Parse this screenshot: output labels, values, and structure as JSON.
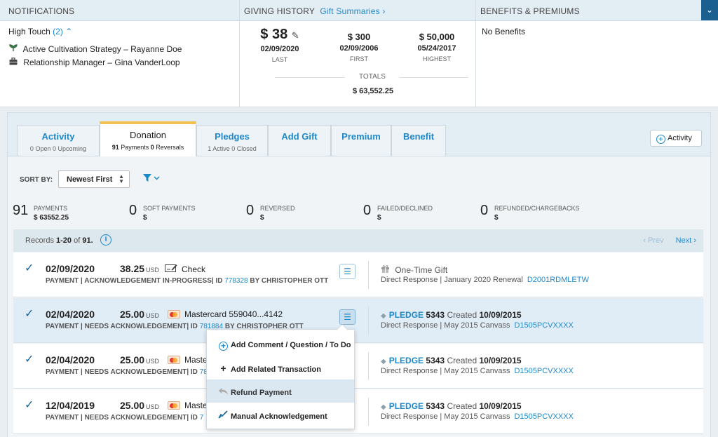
{
  "notifications": {
    "header": "NOTIFICATIONS",
    "high_touch_label": "High Touch",
    "high_touch_count": "(2)",
    "items": [
      {
        "icon": "sprout-icon",
        "text": "Active Cultivation Strategy – Rayanne Doe"
      },
      {
        "icon": "briefcase-icon",
        "text": "Relationship Manager – Gina VanderLoop"
      }
    ]
  },
  "giving_history": {
    "header": "GIVING HISTORY",
    "link": "Gift Summaries",
    "last": {
      "amount": "$ 38",
      "date": "02/09/2020",
      "label": "LAST"
    },
    "first": {
      "amount": "$ 300",
      "date": "02/09/2006",
      "label": "FIRST"
    },
    "highest": {
      "amount": "$ 50,000",
      "date": "05/24/2017",
      "label": "HIGHEST"
    },
    "totals_label": "TOTALS",
    "totals_amount": "$ 63,552.25"
  },
  "benefits": {
    "header": "BENEFITS & PREMIUMS",
    "text": "No Benefits"
  },
  "tabs": [
    {
      "label": "Activity",
      "sub_a_num": "0",
      "sub_a": "Open",
      "sub_b_num": "0",
      "sub_b": "Upcoming"
    },
    {
      "label": "Donation",
      "sub_a_num": "91",
      "sub_a": "Payments",
      "sub_b_num": "0",
      "sub_b": "Reversals"
    },
    {
      "label": "Pledges",
      "sub_a_num": "1",
      "sub_a": "Active",
      "sub_b_num": "0",
      "sub_b": "Closed"
    },
    {
      "label": "Add Gift"
    },
    {
      "label": "Premium"
    },
    {
      "label": "Benefit"
    }
  ],
  "activity_button": "Activity",
  "sort": {
    "label": "SORT BY:",
    "value": "Newest First"
  },
  "stats": [
    {
      "num": "91",
      "label": "PAYMENTS",
      "value": "$ 63552.25"
    },
    {
      "num": "0",
      "label": "SOFT PAYMENTS",
      "value": "$"
    },
    {
      "num": "0",
      "label": "REVERSED",
      "value": "$"
    },
    {
      "num": "0",
      "label": "FAILED/DECLINED",
      "value": "$"
    },
    {
      "num": "0",
      "label": "REFUNDED/CHARGEBACKS",
      "value": "$"
    }
  ],
  "records": {
    "prefix": "Records",
    "range": "1-20",
    "of": "of",
    "total": "91.",
    "prev": "‹ Prev",
    "next": "Next ›"
  },
  "rows": [
    {
      "date": "02/09/2020",
      "amount": "38.25",
      "currency": "USD",
      "method_icon": "check-icon",
      "method": "Check",
      "sub_prefix": "PAYMENT | ACKNOWLEDGEMENT IN-PROGRESS| ID",
      "id": "778328",
      "sub_suffix": "BY CHRISTOPHER OTT",
      "right_icon": "gift-icon",
      "right_title": "One-Time Gift",
      "right_sub": "Direct Response | January 2020 Renewal",
      "right_code": "D2001RDMLETW"
    },
    {
      "date": "02/04/2020",
      "amount": "25.00",
      "currency": "USD",
      "method_icon": "mastercard-icon",
      "method": "Mastercard 559040...4142",
      "sub_prefix": "PAYMENT | NEEDS ACKNOWLEDGEMENT| ID",
      "id": "781884",
      "sub_suffix": "BY CHRISTOPHER OTT",
      "pledge_label": "PLEDGE",
      "pledge_num": "5343",
      "pledge_created": "Created",
      "pledge_date": "10/09/2015",
      "right_sub": "Direct Response | May 2015 Canvass",
      "right_code": "D1505PCVXXXX"
    },
    {
      "date": "02/04/2020",
      "amount": "25.00",
      "currency": "USD",
      "method_icon": "mastercard-icon",
      "method": "Maste",
      "sub_prefix": "PAYMENT | NEEDS ACKNOWLEDGEMENT| ID",
      "id": "78",
      "pledge_label": "PLEDGE",
      "pledge_num": "5343",
      "pledge_created": "Created",
      "pledge_date": "10/09/2015",
      "right_sub": "Direct Response | May 2015 Canvass",
      "right_code": "D1505PCVXXXX"
    },
    {
      "date": "12/04/2019",
      "amount": "25.00",
      "currency": "USD",
      "method_icon": "mastercard-icon",
      "method": "Maste",
      "sub_prefix": "PAYMENT | NEEDS ACKNOWLEDGEMENT| ID",
      "id": "7",
      "pledge_label": "PLEDGE",
      "pledge_num": "5343",
      "pledge_created": "Created",
      "pledge_date": "10/09/2015",
      "right_sub": "Direct Response | May 2015 Canvass",
      "right_code": "D1505PCVXXXX"
    }
  ],
  "dropdown": [
    {
      "icon": "plus-circle-icon",
      "label": "Add Comment / Question / To Do"
    },
    {
      "icon": "plus-icon",
      "label": "Add Related Transaction"
    },
    {
      "icon": "undo-arrow-icon",
      "label": "Refund Payment"
    },
    {
      "icon": "acknowledge-icon",
      "label": "Manual Acknowledgement"
    }
  ],
  "colors": {
    "accent": "#1e88c9",
    "header_bg": "#e3edf4",
    "active_tab_border": "#f2c14e",
    "highlight_row": "#e1edf6"
  }
}
